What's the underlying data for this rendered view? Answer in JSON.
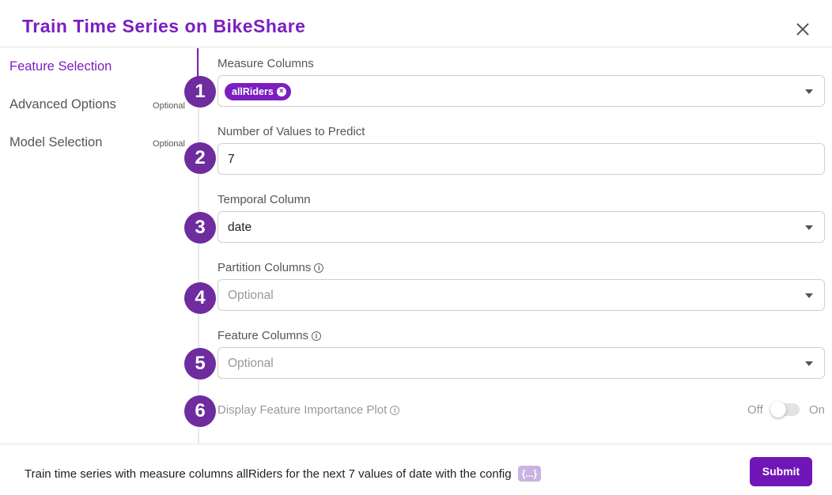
{
  "dialog": {
    "title": "Train Time Series on BikeShare",
    "close_icon": "close-icon"
  },
  "sidebar": {
    "items": [
      {
        "label": "Feature Selection",
        "optional": "",
        "active": true
      },
      {
        "label": "Advanced Options",
        "optional": "Optional",
        "active": false
      },
      {
        "label": "Model Selection",
        "optional": "Optional",
        "active": false
      }
    ]
  },
  "steps": [
    "1",
    "2",
    "3",
    "4",
    "5",
    "6"
  ],
  "form": {
    "measure_columns": {
      "label": "Measure Columns",
      "tags": [
        "allRiders"
      ]
    },
    "num_values": {
      "label": "Number of Values to Predict",
      "value": "7"
    },
    "temporal_column": {
      "label": "Temporal Column",
      "value": "date"
    },
    "partition_columns": {
      "label": "Partition Columns",
      "placeholder": "Optional"
    },
    "feature_columns": {
      "label": "Feature Columns",
      "placeholder": "Optional"
    },
    "feature_importance": {
      "label": "Display Feature Importance Plot",
      "off_label": "Off",
      "on_label": "On",
      "enabled": false
    }
  },
  "footer": {
    "summary": "Train time series with measure columns allRiders for the next 7 values of date with the config",
    "config_chip": "{...}",
    "submit_label": "Submit"
  },
  "colors": {
    "accent": "#7b1fc0",
    "step_badge": "#6e2c9f",
    "submit": "#7016b8"
  }
}
